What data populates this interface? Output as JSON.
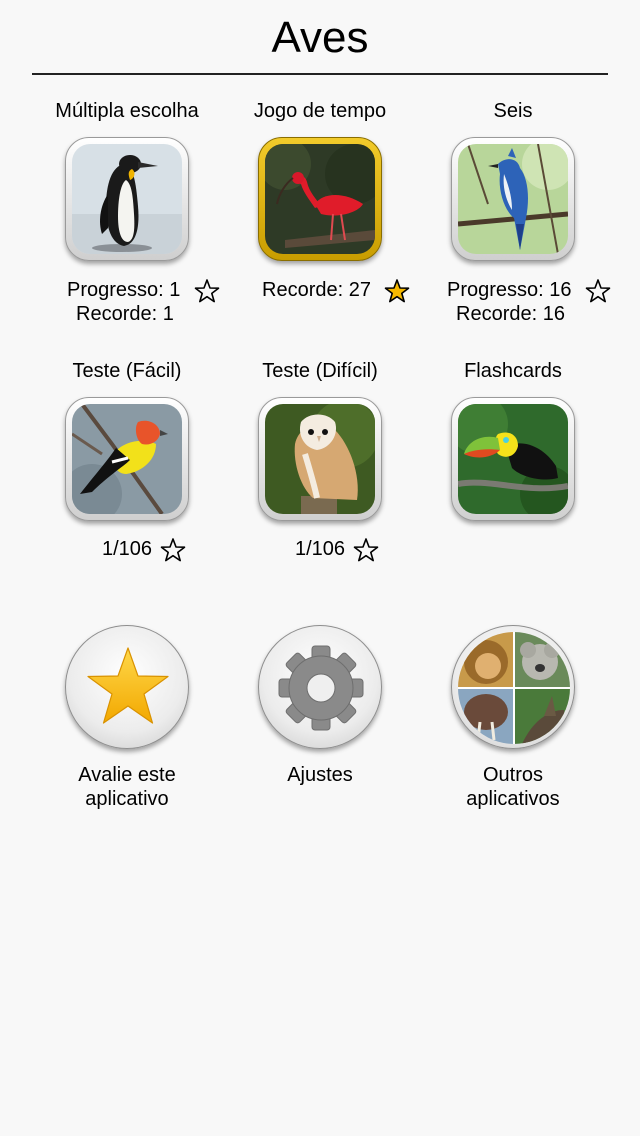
{
  "header": {
    "title": "Aves"
  },
  "modes": [
    {
      "label": "Múltipla escolha",
      "stats": [
        "Progresso: 1",
        "Recorde: 1"
      ],
      "star": "empty"
    },
    {
      "label": "Jogo de tempo",
      "stats": [
        "Recorde: 27"
      ],
      "star": "filled"
    },
    {
      "label": "Seis",
      "stats": [
        "Progresso: 16",
        "Recorde: 16"
      ],
      "star": "empty"
    },
    {
      "label": "Teste (Fácil)",
      "stats": [
        "1/106"
      ],
      "star": "empty"
    },
    {
      "label": "Teste (Difícil)",
      "stats": [
        "1/106"
      ],
      "star": "empty"
    },
    {
      "label": "Flashcards",
      "stats": [],
      "star": "none"
    }
  ],
  "actions": [
    {
      "label_line1": "Avalie este",
      "label_line2": "aplicativo",
      "icon": "star-icon"
    },
    {
      "label_line1": "Ajustes",
      "label_line2": "",
      "icon": "gear-icon"
    },
    {
      "label_line1": "Outros",
      "label_line2": "aplicativos",
      "icon": "animals-collage-icon"
    }
  ],
  "colors": {
    "star_gold": "#f5b800",
    "tile_gold": "#e2b50f",
    "divider": "#222222"
  }
}
